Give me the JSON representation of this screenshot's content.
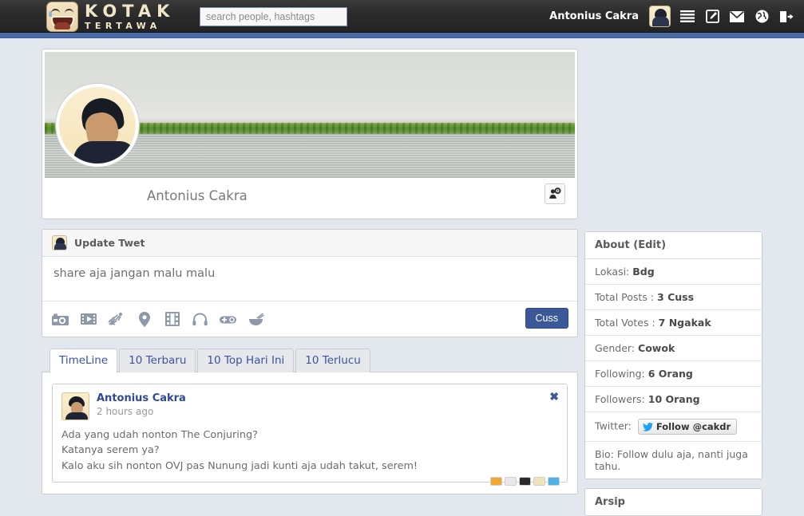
{
  "header": {
    "logo_line1": "KOTAK",
    "logo_line2": "TERTAWA",
    "logo_icon": "laughing-face-logo",
    "search_placeholder": "search people, hashtags",
    "search_value": "",
    "username": "Antonius Cakra",
    "icons": [
      {
        "name": "menu-icon",
        "label": "Menu"
      },
      {
        "name": "compose-icon",
        "label": "Compose"
      },
      {
        "name": "mail-icon",
        "label": "Messages"
      },
      {
        "name": "globe-icon",
        "label": "Notifications"
      },
      {
        "name": "logout-icon",
        "label": "Logout"
      }
    ],
    "accent_color": "#4a6aa5",
    "bar_color": "#2b2b2b"
  },
  "profile": {
    "name": "Antonius Cakra",
    "cover_alt": "landscape-cover-photo",
    "settings_icon": "user-settings-icon"
  },
  "composer": {
    "title": "Update Twet",
    "text": "share aja jangan malu malu",
    "submit_label": "Cuss",
    "submit_color": "#3b5998",
    "tools": [
      {
        "name": "camera-icon"
      },
      {
        "name": "video-ticket-icon"
      },
      {
        "name": "fireworks-icon"
      },
      {
        "name": "location-pin-icon"
      },
      {
        "name": "film-icon"
      },
      {
        "name": "headphones-icon"
      },
      {
        "name": "gamepad-icon"
      },
      {
        "name": "noodle-bowl-icon"
      }
    ]
  },
  "tabs": [
    {
      "label": "TimeLine",
      "active": true
    },
    {
      "label": "10 Terbaru",
      "active": false
    },
    {
      "label": "10 Top Hari Ini",
      "active": false
    },
    {
      "label": "10 Terlucu",
      "active": false
    }
  ],
  "posts": [
    {
      "author": "Antonius Cakra",
      "time": "2 hours ago",
      "close_label": "✖",
      "lines": [
        "Ada yang udah nonton The Conjuring?",
        "Katanya serem ya?",
        "Kalo aku sih nonton OVJ pas Nunung jadi kunti aja udah takut, serem!"
      ],
      "reactions": [
        "#f0a830",
        "#e8e8e8",
        "#2a2a2a",
        "#efe3b8",
        "#4fb3e8"
      ]
    }
  ],
  "about": {
    "title": "About (Edit)",
    "rows": [
      {
        "label": "Lokasi:",
        "value": "Bdg"
      },
      {
        "label": "Total Posts :",
        "value": "3 Cuss"
      },
      {
        "label": "Total Votes :",
        "value": "7 Ngakak"
      },
      {
        "label": "Gender:",
        "value": "Cowok"
      },
      {
        "label": "Following:",
        "value": "6 Orang"
      },
      {
        "label": "Followers:",
        "value": "10 Orang"
      }
    ],
    "twitter_label": "Twitter:",
    "twitter_button": "Follow @cakdr",
    "twitter_icon": "twitter-bird-icon",
    "bio": "Bio: Follow dulu aja, nanti juga tahu."
  },
  "arsip": {
    "title": "Arsip"
  }
}
